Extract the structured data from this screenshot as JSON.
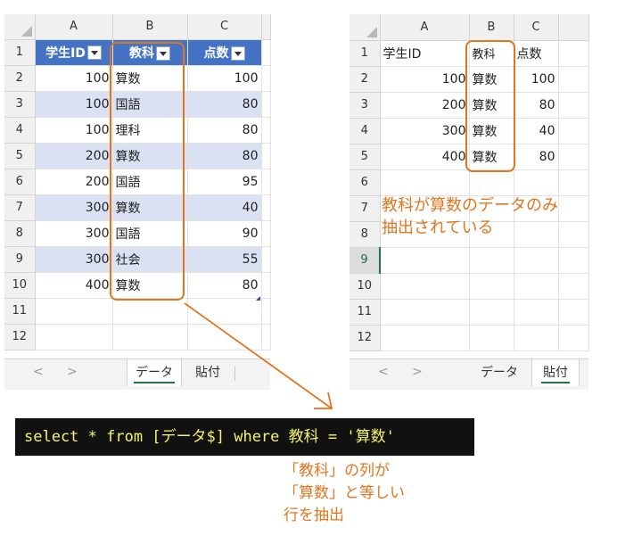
{
  "left_sheet": {
    "columns": [
      "A",
      "B",
      "C"
    ],
    "row_numbers": [
      "1",
      "2",
      "3",
      "4",
      "5",
      "6",
      "7",
      "8",
      "9",
      "10",
      "11",
      "12"
    ],
    "table_headers": [
      "学生ID",
      "教科",
      "点数"
    ],
    "rows": [
      [
        "100",
        "算数",
        "100"
      ],
      [
        "100",
        "国語",
        "80"
      ],
      [
        "100",
        "理科",
        "80"
      ],
      [
        "200",
        "算数",
        "80"
      ],
      [
        "200",
        "国語",
        "95"
      ],
      [
        "300",
        "算数",
        "40"
      ],
      [
        "300",
        "国語",
        "90"
      ],
      [
        "300",
        "社会",
        "55"
      ],
      [
        "400",
        "算数",
        "80"
      ]
    ],
    "tabs": [
      "データ",
      "貼付"
    ],
    "active_tab": "データ",
    "nav_prev": "<",
    "nav_next": ">"
  },
  "right_sheet": {
    "columns": [
      "A",
      "B",
      "C"
    ],
    "row_numbers": [
      "1",
      "2",
      "3",
      "4",
      "5",
      "6",
      "7",
      "8",
      "9",
      "10",
      "11",
      "12"
    ],
    "headers": [
      "学生ID",
      "教科",
      "点数"
    ],
    "rows": [
      [
        "100",
        "算数",
        "100"
      ],
      [
        "200",
        "算数",
        "80"
      ],
      [
        "300",
        "算数",
        "40"
      ],
      [
        "400",
        "算数",
        "80"
      ]
    ],
    "selected_row": "9",
    "tabs": [
      "データ",
      "貼付"
    ],
    "active_tab": "貼付",
    "nav_prev": "<",
    "nav_next": ">"
  },
  "annotations": {
    "result_note_line1": "教科が算数のデータのみ",
    "result_note_line2": "抽出されている",
    "sql_query": "select * from [データ$] where 教科 = '算数'",
    "sql_note_line1": "「教科」の列が",
    "sql_note_line2": "「算数」と等しい",
    "sql_note_line3": "行を抽出"
  },
  "colors": {
    "accent_orange": "#e1761f",
    "table_header_blue": "#4472c4",
    "band_blue": "#d9e1f2",
    "sql_text": "#f4f46a",
    "sql_bg": "#111111"
  }
}
